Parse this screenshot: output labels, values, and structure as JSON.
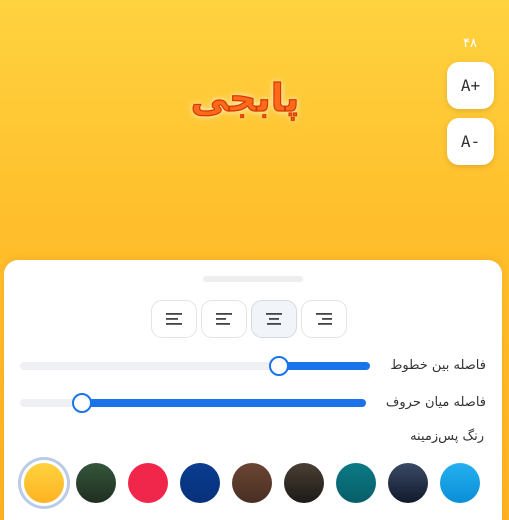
{
  "preview": {
    "text": "پابجی",
    "text_color": "#ff6a1a",
    "stroke_color": "#d23a00"
  },
  "font_size": {
    "value": "۴۸",
    "increase_label": "A+",
    "decrease_label": "A-"
  },
  "alignment": {
    "options": [
      "left",
      "left-short",
      "center",
      "right"
    ],
    "selected": "center"
  },
  "sliders": {
    "line_spacing": {
      "label": "فاصله بین خطوط",
      "fill_percent": 74
    },
    "letter_spacing": {
      "label": "فاصله میان حروف",
      "fill_percent": 18
    }
  },
  "background": {
    "label": "رنگ پس‌زمینه",
    "selected_index": 0,
    "swatches": [
      {
        "id": "yellow-gradient",
        "from": "#ffd23f",
        "to": "#ffb322"
      },
      {
        "id": "dark-green",
        "from": "#35553a",
        "to": "#1f2f22"
      },
      {
        "id": "crimson",
        "from": "#f0264b",
        "to": "#f0264b"
      },
      {
        "id": "royal-blue",
        "from": "#0a3d91",
        "to": "#06307a"
      },
      {
        "id": "brown",
        "from": "#6a4634",
        "to": "#4a2e22"
      },
      {
        "id": "dark-olive",
        "from": "#4a3f33",
        "to": "#1c1a17"
      },
      {
        "id": "teal",
        "from": "#0b7a86",
        "to": "#065e68"
      },
      {
        "id": "navy",
        "from": "#3a4a66",
        "to": "#121a2c"
      },
      {
        "id": "sky-blue",
        "from": "#25b0f0",
        "to": "#0a8ed6"
      }
    ]
  },
  "colors": {
    "accent": "#1a73e8",
    "background_gradient_top": "#ffd23f",
    "background_gradient_bottom": "#ffb322"
  }
}
